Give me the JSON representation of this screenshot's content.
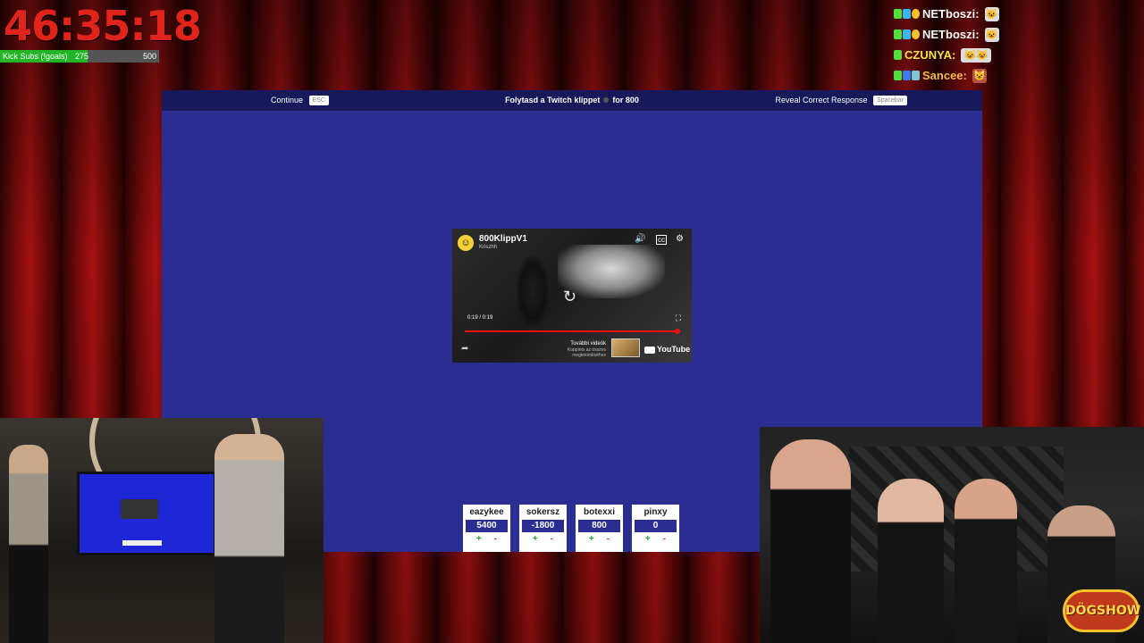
{
  "stream": {
    "timer": "46:35:18",
    "subs_goal": {
      "label": "Kick Subs (!goals)",
      "current": "275",
      "goal": "500",
      "progress_fraction": 0.55
    }
  },
  "chat": [
    {
      "user": "NETboszi:",
      "color": "#ffffff",
      "emote": "😺"
    },
    {
      "user": "NETboszi:",
      "color": "#ffffff",
      "emote": "😺"
    },
    {
      "user": "CZUNYA:",
      "color": "#f2e34a",
      "emote": "😺😺"
    },
    {
      "user": "Sancee:",
      "color": "#f2b84b",
      "emote": "😺"
    }
  ],
  "game": {
    "continue_label": "Continue",
    "continue_key": "ESC",
    "question_prefix": "Folytasd a Twitch klippet",
    "question_points": "for 800",
    "reveal_label": "Reveal Correct Response",
    "reveal_key": "Spacebar"
  },
  "video": {
    "title": "800KlippV1",
    "channel": "Kriszhh",
    "time": "0:19 / 0:19",
    "more_videos": "További videók",
    "more_videos_sub": "Koppints az összes megtekintéséhez",
    "platform": "YouTube",
    "progress_fraction": 1.0
  },
  "scores": [
    {
      "name": "eazykee",
      "value": "5400",
      "plus": "+",
      "minus": "-"
    },
    {
      "name": "sokersz",
      "value": "-1800",
      "plus": "+",
      "minus": "-"
    },
    {
      "name": "botexxi",
      "value": "800",
      "plus": "+",
      "minus": "-"
    },
    {
      "name": "pinxy",
      "value": "0",
      "plus": "+",
      "minus": "-"
    }
  ],
  "logo": "DÖGSHOW",
  "colors": {
    "panel": "#2b2d93",
    "topbar": "#17195a",
    "timer": "#e0231b",
    "subs_fill": "#22b526"
  }
}
